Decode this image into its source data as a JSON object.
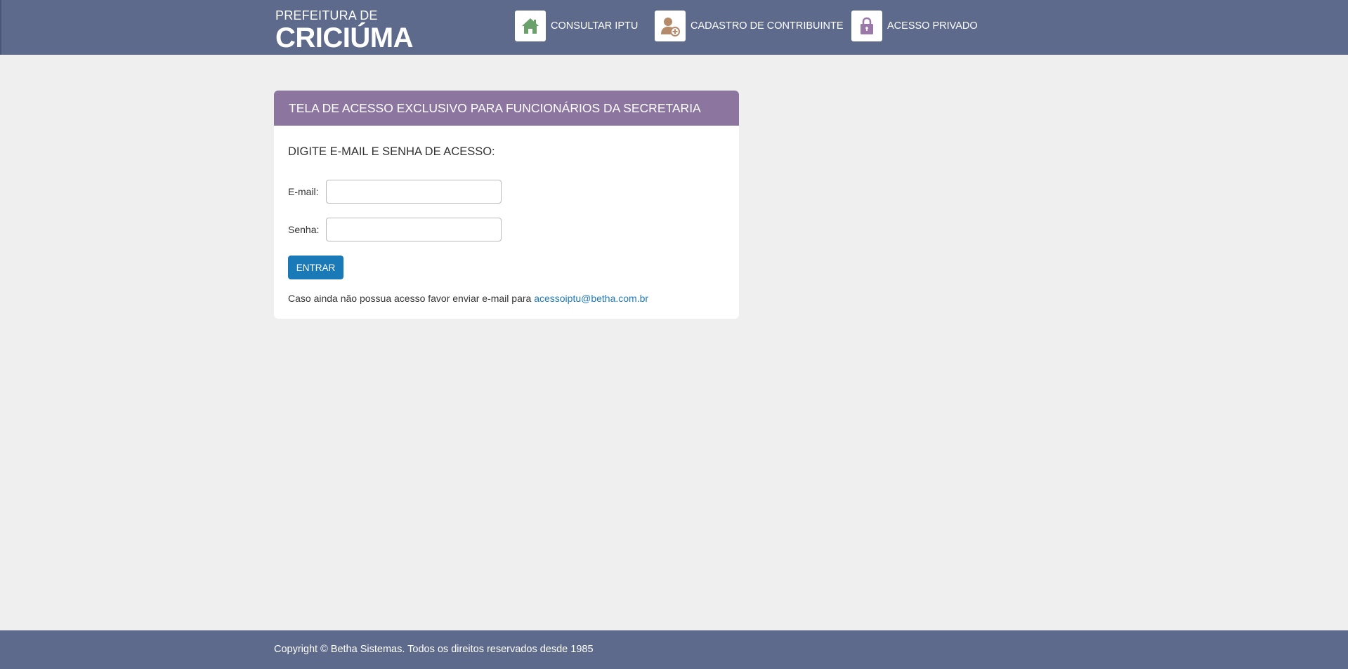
{
  "header": {
    "brand_small": "PREFEITURA DE",
    "brand_big": "CRICIÚMA",
    "nav": [
      {
        "label": "CONSULTAR IPTU",
        "icon": "house-icon",
        "icon_color": "#6aa06a"
      },
      {
        "label": "CADASTRO DE CONTRIBUINTE",
        "icon": "user-add-icon",
        "icon_color": "#b58a6a"
      },
      {
        "label": "ACESSO PRIVADO",
        "icon": "padlock-icon",
        "icon_color": "#9a79a8"
      }
    ]
  },
  "panel": {
    "title": "TELA DE ACESSO EXCLUSIVO PARA FUNCIONÁRIOS DA SECRETARIA",
    "instructions": "DIGITE E-MAIL E SENHA DE ACESSO:",
    "email_label": "E-mail:",
    "email_value": "",
    "senha_label": "Senha:",
    "senha_value": "",
    "submit_label": "ENTRAR",
    "note_text": "Caso ainda não possua acesso favor enviar e-mail para",
    "note_link": "acessoiptu@betha.com.br"
  },
  "footer": {
    "copyright": "Copyright © Betha Sistemas. Todos os direitos reservados desde 1985"
  },
  "colors": {
    "header_bg": "#5d6a8b",
    "panel_header_bg": "#8c76a0",
    "button_bg": "#1a7ab8",
    "link": "#1f7ab8",
    "page_bg": "#efefef"
  }
}
